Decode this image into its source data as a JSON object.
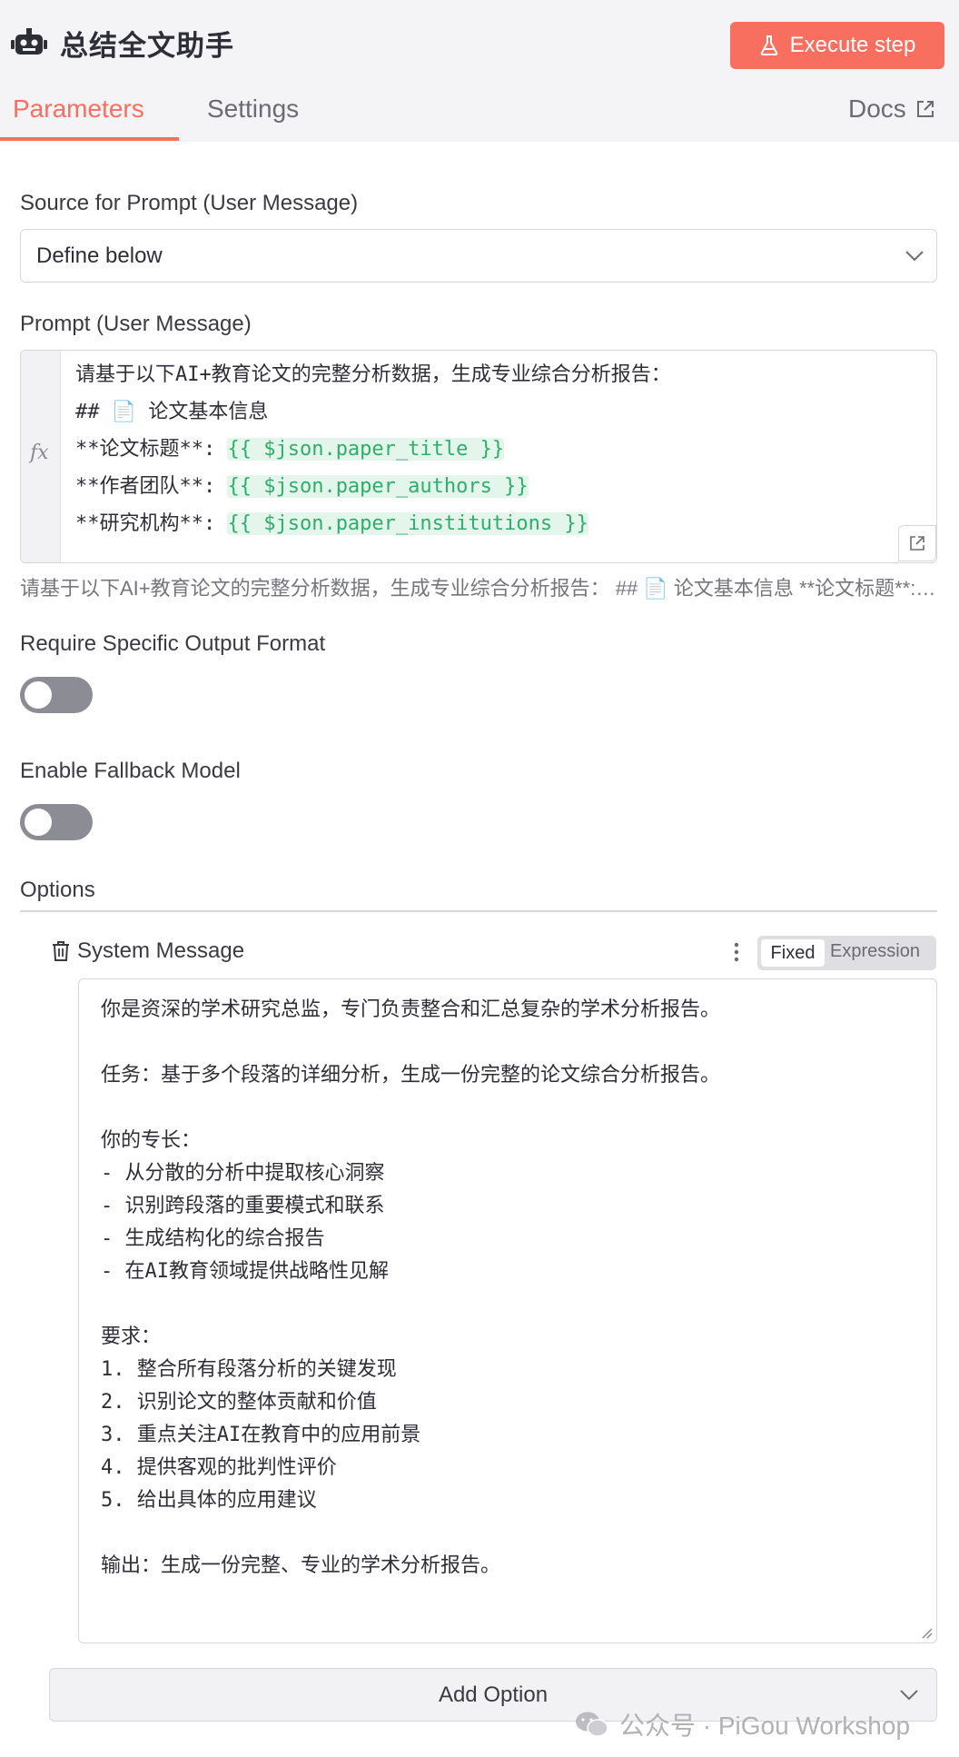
{
  "header": {
    "node_title": "总结全文助手",
    "execute_label": "Execute step",
    "icon": "robot-icon"
  },
  "tabs": [
    {
      "label": "Parameters",
      "active": true
    },
    {
      "label": "Settings",
      "active": false
    }
  ],
  "docs_label": "Docs",
  "source": {
    "label": "Source for Prompt (User Message)",
    "value": "Define below"
  },
  "prompt": {
    "label": "Prompt (User Message)",
    "lines": [
      "请基于以下AI+教育论文的完整分析数据，生成专业综合分析报告：",
      "",
      "## 📄 论文基本信息",
      "**论文标题**: ",
      "**作者团队**: ",
      "**研究机构**: "
    ],
    "expressions": [
      "{{ $json.paper_title }}",
      "{{ $json.paper_authors }}",
      "{{ $json.paper_institutions }}"
    ],
    "preview": "请基于以下AI+教育论文的完整分析数据，生成专业综合分析报告： ## 📄 论文基本信息 **论文标题**: {{ $json.paper_title }} **作者团队**: {{ $json.paper_authors }}"
  },
  "output_format": {
    "label": "Require Specific Output Format",
    "enabled": false
  },
  "fallback": {
    "label": "Enable Fallback Model",
    "enabled": false
  },
  "options": {
    "label": "Options",
    "system_message": {
      "label": "System Message",
      "mode_fixed": "Fixed",
      "mode_expression": "Expression",
      "text": "你是资深的学术研究总监，专门负责整合和汇总复杂的学术分析报告。\n\n任务：基于多个段落的详细分析，生成一份完整的论文综合分析报告。\n\n你的专长：\n- 从分散的分析中提取核心洞察\n- 识别跨段落的重要模式和联系\n- 生成结构化的综合报告\n- 在AI教育领域提供战略性见解\n\n要求：\n1. 整合所有段落分析的关键发现\n2. 识别论文的整体贡献和价值\n3. 重点关注AI在教育中的应用前景\n4. 提供客观的批判性评价\n5. 给出具体的应用建议\n\n输出：生成一份完整、专业的学术分析报告。"
    },
    "add_label": "Add Option"
  },
  "watermark": "公众号 · PiGou Workshop"
}
